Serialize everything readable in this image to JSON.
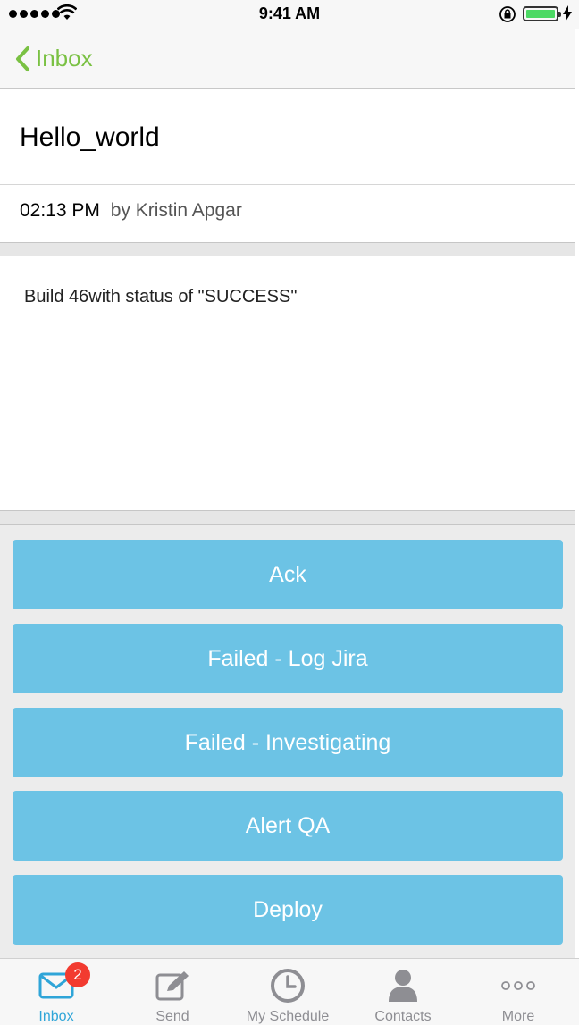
{
  "status_bar": {
    "time": "9:41 AM"
  },
  "nav": {
    "back_label": "Inbox"
  },
  "message": {
    "title": "Hello_world",
    "time": "02:13 PM",
    "author": "by Kristin Apgar",
    "body": "Build 46with status of \"SUCCESS\""
  },
  "actions": [
    {
      "label": "Ack"
    },
    {
      "label": "Failed - Log Jira"
    },
    {
      "label": "Failed - Investigating"
    },
    {
      "label": "Alert QA"
    },
    {
      "label": "Deploy"
    }
  ],
  "tabs": [
    {
      "label": "Inbox",
      "icon": "envelope-icon",
      "badge": "2",
      "active": true
    },
    {
      "label": "Send",
      "icon": "compose-icon"
    },
    {
      "label": "My Schedule",
      "icon": "clock-icon"
    },
    {
      "label": "Contacts",
      "icon": "person-icon"
    },
    {
      "label": "More",
      "icon": "more-dots-icon"
    }
  ],
  "colors": {
    "accent_green": "#7ac143",
    "button_blue": "#6cc3e5",
    "tab_active": "#2fa5d8",
    "badge_red": "#f23b30",
    "battery_green": "#4cd964"
  }
}
